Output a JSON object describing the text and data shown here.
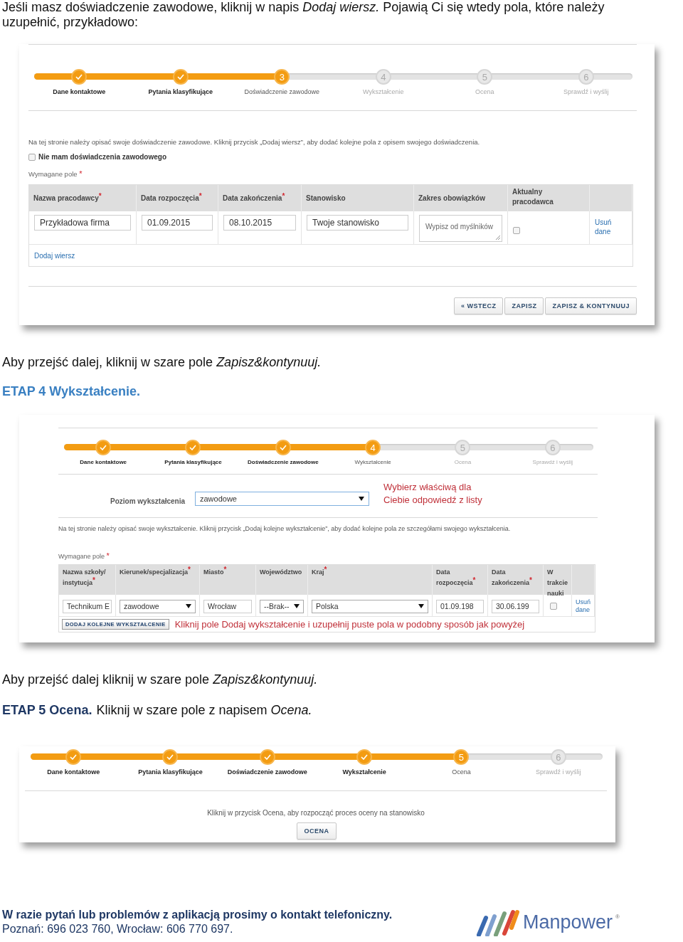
{
  "intro": "Jeśli masz doświadczenie zawodowe, kliknij w napis *Dodaj wiersz.* Pojawią Ci się wtedy pola, które należy uzupełnić, przykładowo:",
  "screen_1": {
    "steps": [
      {
        "label": "Dane kontaktowe",
        "completed": true,
        "selected": false
      },
      {
        "label": "Pytania klasyfikujące",
        "completed": true,
        "selected": false
      },
      {
        "label": "Doświadczenie zawodowe",
        "completed": false,
        "selected": true,
        "number": "3"
      },
      {
        "label": "Wykształcenie",
        "completed": false,
        "selected": false,
        "number": "4"
      },
      {
        "label": "Ocena",
        "completed": false,
        "selected": false,
        "number": "5"
      },
      {
        "label": "Sprawdź i wyślij",
        "completed": false,
        "selected": false,
        "number": "6"
      }
    ],
    "info": "Na tej stronie należy opisać swoje doświadczenie zawodowe. Kliknij przycisk „Dodaj wiersz”, aby dodać kolejne pola z opisem swojego doświadczenia.",
    "no_experience": {
      "label": "Nie mam doświadczenia zawodowego",
      "checked": false
    },
    "required_note": "Wymagane pole",
    "required_mark": "*",
    "table": {
      "columns": [
        {
          "label": "Nazwa pracodawcy",
          "required": true
        },
        {
          "label": "Data rozpoczęcia",
          "required": true
        },
        {
          "label": "Data zakończenia",
          "required": true
        },
        {
          "label": "Stanowisko",
          "required": false
        },
        {
          "label": "Zakres obowiązków",
          "required": false
        },
        {
          "label": "Aktualny pracodawca",
          "required": false
        },
        {
          "required": false
        }
      ],
      "rows": [
        [
          {
            "kind": "input",
            "value": "Przykładowa firma"
          },
          {
            "kind": "input",
            "value": "01.09.2015"
          },
          {
            "kind": "input",
            "value": "08.10.2015"
          },
          {
            "kind": "input",
            "value": "Twoje stanowisko"
          },
          {
            "kind": "textarea",
            "placeholder": "Wypisz od myślników"
          },
          {
            "kind": "checkbox",
            "checked": false
          },
          {
            "kind": "link",
            "value": "Usuń dane"
          }
        ]
      ]
    },
    "add_row_link": "Dodaj wiersz",
    "buttons": [
      "« WSTECZ",
      "ZAPISZ",
      "ZAPISZ & KONTYNUUJ"
    ]
  },
  "note_1": "Aby przejść dalej, kliknij w szare pole *Zapisz&kontynuuj.*",
  "stage_4_heading": "ETAP 4 Wykształcenie.",
  "screen_2": {
    "steps": [
      {
        "label": "Dane kontaktowe",
        "completed": true,
        "selected": false
      },
      {
        "label": "Pytania klasyfikujące",
        "completed": true,
        "selected": false
      },
      {
        "label": "Doświadczenie zawodowe",
        "completed": true,
        "selected": false
      },
      {
        "label": "Wykształcenie",
        "completed": false,
        "selected": true,
        "number": "4"
      },
      {
        "label": "Ocena",
        "completed": false,
        "selected": false,
        "number": "5"
      },
      {
        "label": "Sprawdź i wyślij",
        "completed": false,
        "selected": false,
        "number": "6"
      }
    ],
    "level_field": {
      "label": "Poziom wykształcenia",
      "value": "zawodowe"
    },
    "level_hint": "Wybierz właściwą dla Ciebie odpowiedź z listy",
    "info": "Na tej stronie należy opisać swoje wykształcenie. Kliknij przycisk „Dodaj kolejne wykształcenie”, aby dodać kolejne pola ze szczegółami swojego wykształcenia.",
    "required_note": "Wymagane pole",
    "required_mark": "*",
    "table": {
      "columns": [
        {
          "label": "Nazwa szkoły/ instytucja",
          "required": true
        },
        {
          "label": "Kierunek/specjalizacja",
          "required": true
        },
        {
          "label": "Miasto",
          "required": true
        },
        {
          "label": "Województwo",
          "required": false
        },
        {
          "label": "Kraj",
          "required": true
        },
        {
          "label": "Data rozpoczęcia",
          "required": true
        },
        {
          "label": "Data zakończenia",
          "required": true
        },
        {
          "label": "W trakcie nauki",
          "required": false
        },
        {
          "required": false
        }
      ],
      "rows": [
        [
          {
            "kind": "input",
            "value": "Technikum E"
          },
          {
            "kind": "select",
            "value": "zawodowe"
          },
          {
            "kind": "input",
            "value": "Wrocław"
          },
          {
            "kind": "select",
            "value": "--Brak--"
          },
          {
            "kind": "select",
            "value": "Polska"
          },
          {
            "kind": "input",
            "value": "01.09.198"
          },
          {
            "kind": "input",
            "value": "30.06.199"
          },
          {
            "kind": "checkbox",
            "checked": false
          },
          {
            "kind": "link",
            "value": "Usuń dane"
          }
        ]
      ]
    },
    "add_button": "DODAJ KOLEJNE WYKSZTAŁCENIE",
    "add_hint": "Kliknij pole Dodaj wykształcenie i uzupełnij puste pola w podobny sposób jak powyżej"
  },
  "note_2": "Aby przejść dalej kliknij w szare pole *Zapisz&kontynuuj.*",
  "stage_5": {
    "heading": "ETAP 5 Ocena.",
    "text": "Kliknij w szare pole z napisem *Ocena.*"
  },
  "screen_3": {
    "steps": [
      {
        "label": "Dane kontaktowe",
        "completed": true,
        "selected": false
      },
      {
        "label": "Pytania klasyfikujące",
        "completed": true,
        "selected": false
      },
      {
        "label": "Doświadczenie zawodowe",
        "completed": true,
        "selected": false
      },
      {
        "label": "Wykształcenie",
        "completed": true,
        "selected": false
      },
      {
        "label": "Ocena",
        "completed": false,
        "selected": true,
        "number": "5"
      },
      {
        "label": "Sprawdź i wyślij",
        "completed": false,
        "selected": false,
        "number": "6"
      }
    ],
    "info": "Kliknij w przycisk Ocena, aby rozpocząć proces oceny na stanowisko",
    "button": "OCENA"
  },
  "footer": {
    "contact": "W razie pytań lub problemów z aplikacją prosimy o kontakt telefoniczny.",
    "phones": "Poznań: 696 023 760, Wrocław: 606 770 697.",
    "logo": {
      "name": "Manpower",
      "mark": "®"
    }
  }
}
